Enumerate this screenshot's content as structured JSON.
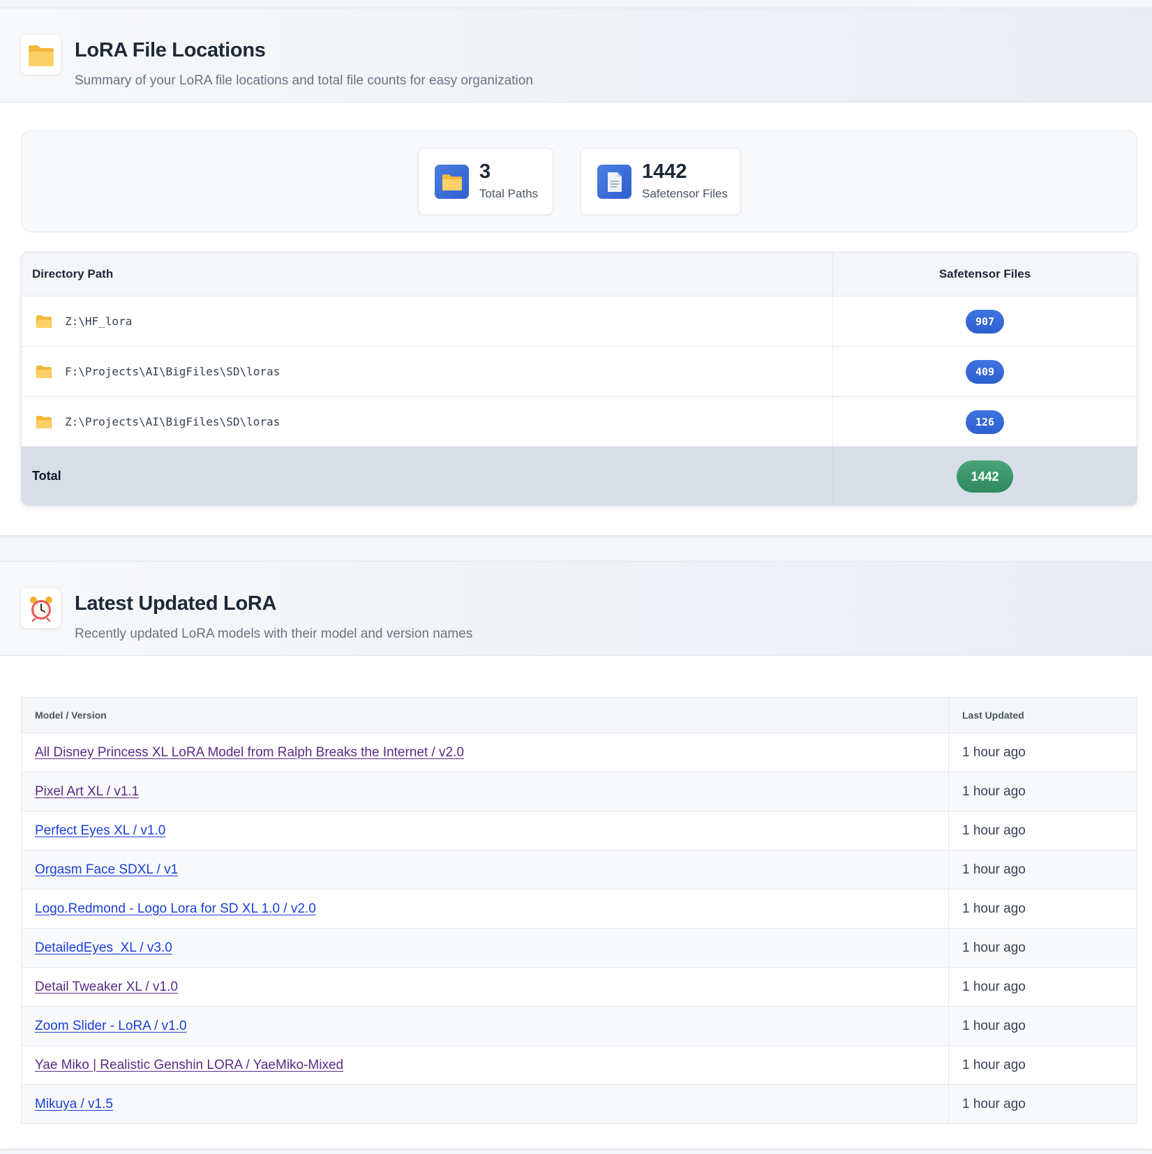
{
  "locations": {
    "title": "LoRA File Locations",
    "subtitle": "Summary of your LoRA file locations and total file counts for easy organization",
    "header_icon": "folder-icon",
    "stats": [
      {
        "value": "3",
        "label": "Total Paths",
        "icon": "folder-icon"
      },
      {
        "value": "1442",
        "label": "Safetensor Files",
        "icon": "file-icon"
      }
    ],
    "table": {
      "col_path": "Directory Path",
      "col_files": "Safetensor Files",
      "rows": [
        {
          "path": "Z:\\HF_lora",
          "count": "907"
        },
        {
          "path": "F:\\Projects\\AI\\BigFiles\\SD\\loras",
          "count": "409"
        },
        {
          "path": "Z:\\Projects\\AI\\BigFiles\\SD\\loras",
          "count": "126"
        }
      ],
      "total_label": "Total",
      "total_value": "1442"
    }
  },
  "latest": {
    "title": "Latest Updated LoRA",
    "subtitle": "Recently updated LoRA models with their model and version names",
    "header_icon": "alarm-clock-icon",
    "table": {
      "col_model": "Model / Version",
      "col_updated": "Last Updated",
      "rows": [
        {
          "model": "All Disney Princess XL LoRA Model from Ralph Breaks the Internet / v2.0",
          "updated": "1 hour ago",
          "visited": true
        },
        {
          "model": "Pixel Art XL / v1.1",
          "updated": "1 hour ago",
          "visited": true
        },
        {
          "model": "Perfect Eyes XL / v1.0",
          "updated": "1 hour ago",
          "visited": false
        },
        {
          "model": "Orgasm Face SDXL / v1",
          "updated": "1 hour ago",
          "visited": false
        },
        {
          "model": "Logo.Redmond - Logo Lora for SD XL 1.0 / v2.0",
          "updated": "1 hour ago",
          "visited": false
        },
        {
          "model": "DetailedEyes_XL / v3.0",
          "updated": "1 hour ago",
          "visited": false
        },
        {
          "model": "Detail Tweaker XL / v1.0",
          "updated": "1 hour ago",
          "visited": true
        },
        {
          "model": "Zoom Slider - LoRA / v1.0",
          "updated": "1 hour ago",
          "visited": false
        },
        {
          "model": "Yae Miko | Realistic Genshin LORA / YaeMiko-Mixed",
          "updated": "1 hour ago",
          "visited": true
        },
        {
          "model": "Mikuya / v1.5",
          "updated": "1 hour ago",
          "visited": false
        }
      ]
    }
  },
  "colors": {
    "accent_blue": "#2d5fcf",
    "total_green": "#2e8a5e",
    "visited_link": "#5b2a86",
    "link": "#1a3fd6",
    "folder_yellow": "#f9c54e"
  }
}
